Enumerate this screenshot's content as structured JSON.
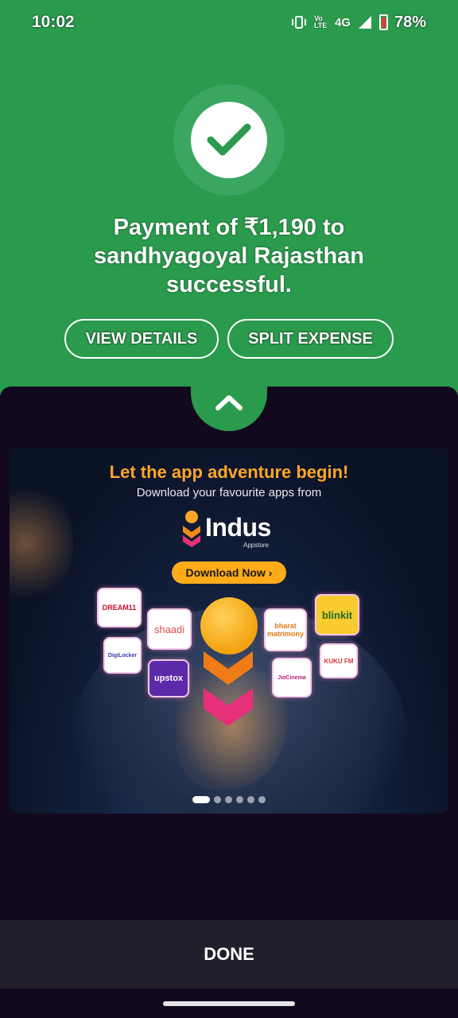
{
  "status_bar": {
    "time": "10:02",
    "network_label": "4G",
    "volte_label": "Vo LTE",
    "battery_percent": "78%"
  },
  "payment": {
    "message": "Payment of ₹1,190 to sandhyagoyal Rajasthan successful.",
    "view_details_label": "VIEW DETAILS",
    "split_expense_label": "SPLIT EXPENSE"
  },
  "banner": {
    "headline": "Let the app adventure begin!",
    "subtitle": "Download your favourite apps from",
    "brand_name": "Indus",
    "brand_sub": "Appstore",
    "cta_label": "Download Now ›",
    "apps": [
      "DREAM11",
      "shaadi",
      "DigiLocker",
      "upstox",
      "bharat matrimony",
      "blinkit",
      "JioCinema",
      "KUKU FM"
    ],
    "carousel": {
      "count": 6,
      "active_index": 0
    }
  },
  "done_label": "DONE",
  "colors": {
    "success_green": "#2a9a4c",
    "sheet_dark": "#12091f",
    "cta_orange": "#ffab1a",
    "headline_orange": "#ffa629"
  },
  "icons": {
    "success": "check-icon",
    "collapse": "chevron-up-icon"
  }
}
